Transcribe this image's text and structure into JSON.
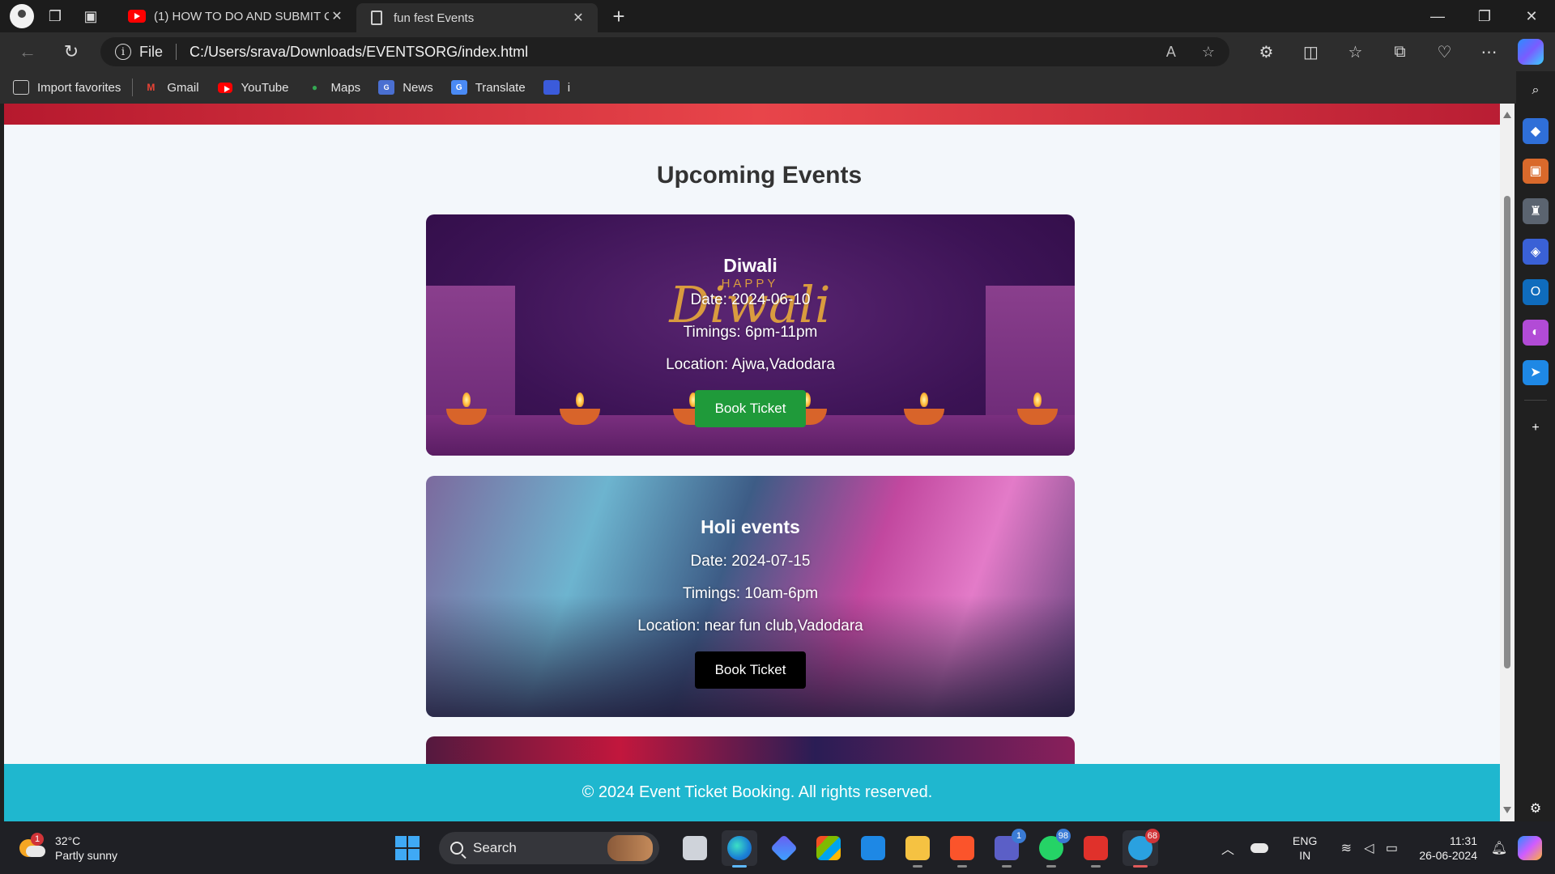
{
  "browser": {
    "tabs": [
      {
        "title": "(1) HOW TO DO AND SUBMIT C",
        "favicon": "youtube-icon",
        "active": false
      },
      {
        "title": "fun fest Events",
        "favicon": "document-icon",
        "active": true
      }
    ],
    "address": {
      "scheme_label": "File",
      "url": "C:/Users/srava/Downloads/EVENTSORG/index.html"
    },
    "favorites": [
      {
        "label": "Import favorites",
        "icon": "import-icon"
      },
      {
        "label": "Gmail",
        "icon": "gmail-icon"
      },
      {
        "label": "YouTube",
        "icon": "youtube-icon"
      },
      {
        "label": "Maps",
        "icon": "maps-icon"
      },
      {
        "label": "News",
        "icon": "news-icon"
      },
      {
        "label": "Translate",
        "icon": "translate-icon"
      },
      {
        "label": "i",
        "icon": "cube-icon"
      }
    ]
  },
  "page": {
    "heading": "Upcoming Events",
    "events": [
      {
        "name": "Diwali",
        "date": "Date: 2024-06-10",
        "timings": "Timings: 6pm-11pm",
        "location": "Location: Ajwa,Vadodara",
        "button": "Book Ticket",
        "button_color": "#1f9a3a",
        "banner_text_small": "HAPPY",
        "banner_text_large": "Diwali"
      },
      {
        "name": "Holi events",
        "date": "Date: 2024-07-15",
        "timings": "Timings: 10am-6pm",
        "location": "Location: near fun club,Vadodara",
        "button": "Book Ticket",
        "button_color": "#000000"
      }
    ],
    "footer": "© 2024 Event Ticket Booking. All rights reserved."
  },
  "taskbar": {
    "weather": {
      "temp": "32°C",
      "condition": "Partly sunny",
      "badge": "1"
    },
    "search_placeholder": "Search",
    "app_badges": {
      "teams": "1",
      "whatsapp": "98",
      "telegram": "68"
    },
    "lang_line1": "ENG",
    "lang_line2": "IN",
    "time": "11:31",
    "date": "26-06-2024"
  },
  "colors": {
    "header_accent": "#d1323f",
    "footer_bg": "#1fb7cf",
    "page_bg": "#f3f7fb"
  }
}
